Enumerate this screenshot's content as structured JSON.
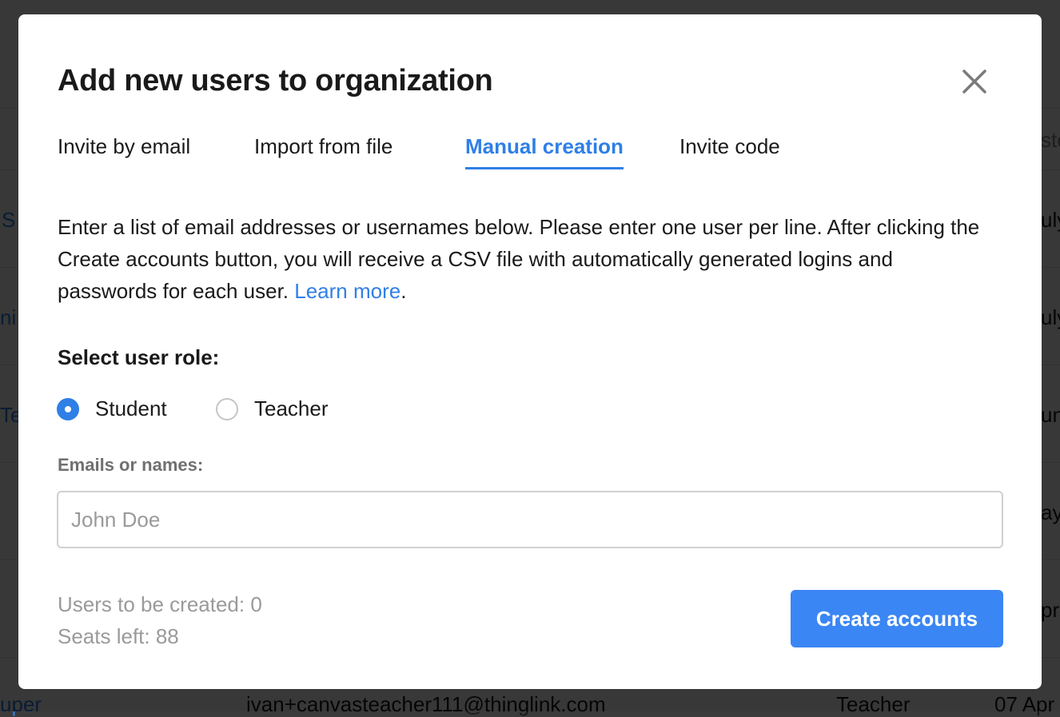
{
  "background": {
    "fragments": [
      "S",
      "ni",
      "Te",
      "uper",
      "ivan+canvasteacher111@thinglink.com",
      "Teacher",
      "07 Apr",
      "sto",
      "uly",
      "uly",
      "un",
      "ay",
      "pr"
    ]
  },
  "modal": {
    "title": "Add new users to organization",
    "close_icon": "close-icon",
    "tabs": [
      {
        "label": "Invite by email",
        "active": false
      },
      {
        "label": "Import from file",
        "active": false
      },
      {
        "label": "Manual creation",
        "active": true
      },
      {
        "label": "Invite code",
        "active": false
      }
    ],
    "description": {
      "text": "Enter a list of email addresses or usernames below. Please enter one user per line. After clicking the Create accounts button, you will receive a CSV file with automatically generated logins and passwords for each user. ",
      "link": "Learn more",
      "end": "."
    },
    "role": {
      "label": "Select user role:",
      "options": [
        {
          "label": "Student",
          "checked": true
        },
        {
          "label": "Teacher",
          "checked": false
        }
      ]
    },
    "emails": {
      "label": "Emails or names:",
      "placeholder": "John Doe",
      "value": ""
    },
    "counts": {
      "users_to_be_created": "Users to be created: 0",
      "seats_left": "Seats left: 88"
    },
    "create_button": "Create accounts"
  },
  "colors": {
    "accent": "#3a86f4",
    "link": "#2f7fe6",
    "overlay": "rgba(0,0,0,0.78)"
  }
}
